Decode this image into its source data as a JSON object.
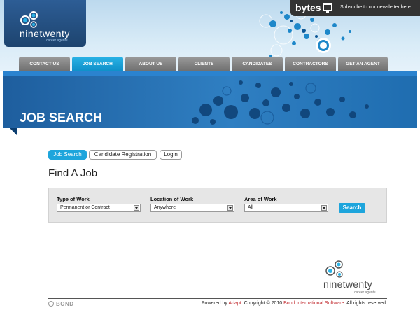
{
  "header": {
    "logo_text": "ninetwenty",
    "logo_sub": "career agents",
    "bytes_label": "bytes",
    "newsletter_label": "Subscribe to our newsletter here"
  },
  "nav": {
    "items": [
      {
        "label": "Contact Us"
      },
      {
        "label": "Job Search",
        "active": true
      },
      {
        "label": "About Us"
      },
      {
        "label": "Clients"
      },
      {
        "label": "Candidates"
      },
      {
        "label": "Contractors"
      },
      {
        "label": "Get An Agent"
      }
    ]
  },
  "banner": {
    "title": "JOB SEARCH"
  },
  "subtabs": {
    "job_search": "Job Search",
    "candidate_registration": "Candidate Registration",
    "login": "Login"
  },
  "main": {
    "title": "Find A Job",
    "type_of_work_label": "Type of Work",
    "type_of_work_value": "Permanent or Contract",
    "location_label": "Location of Work",
    "location_value": "Anywhere",
    "area_label": "Area of Work",
    "area_value": "All",
    "search_label": "Search"
  },
  "footer": {
    "logo_text": "ninetwenty",
    "logo_sub": "career agents",
    "bond_label": "BOND",
    "powered_by": "Powered by ",
    "adapt_link": "Adapt",
    "copyright_mid": ". Copyright © 2010 ",
    "bond_link": "Bond International Software",
    "rights": ". All rights reserved."
  },
  "colors": {
    "accent": "#1ea5dc",
    "nav_grey": "#7f7f7f",
    "banner_blue": "#2f7fc2",
    "link_red": "#c0282d"
  }
}
